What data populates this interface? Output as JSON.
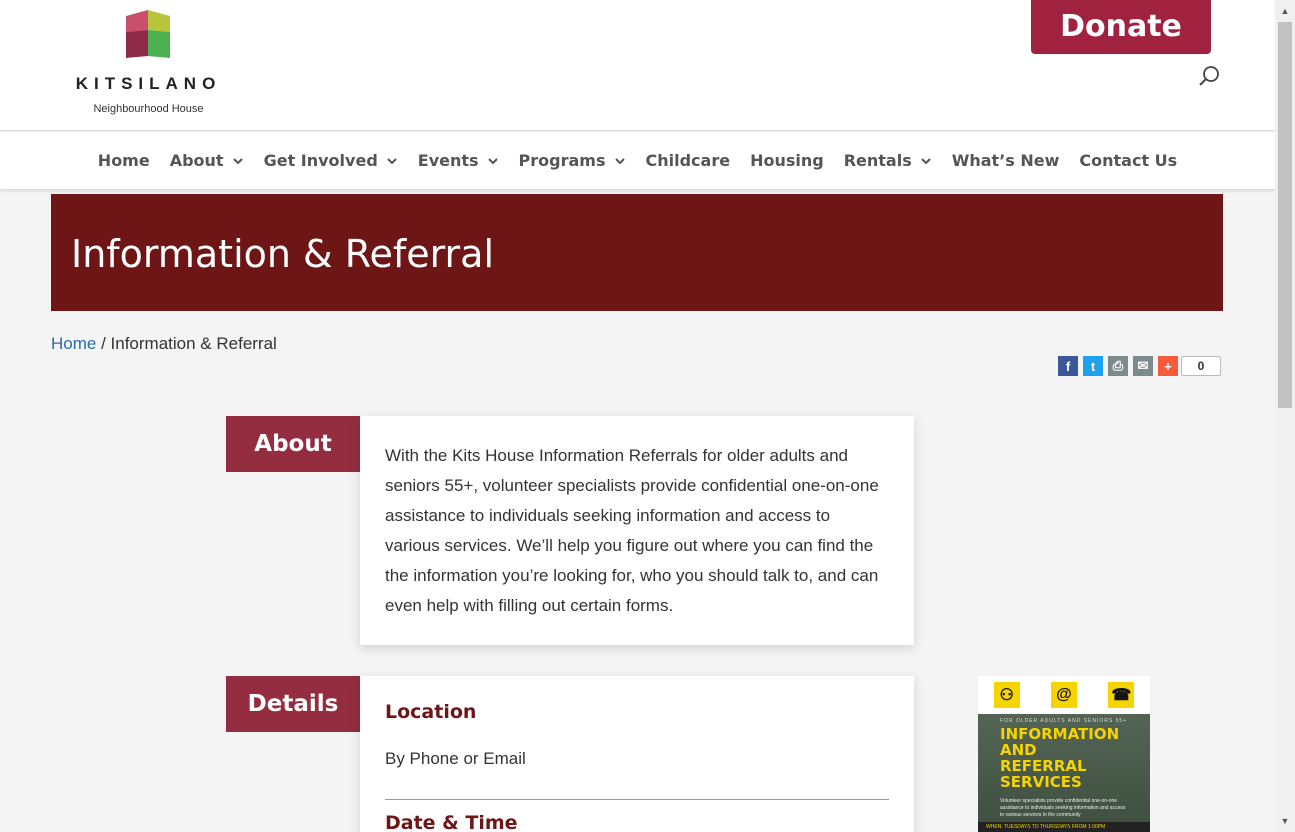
{
  "header": {
    "logo_title": "KITSILANO",
    "logo_subtitle": "Neighbourhood House",
    "donate_label": "Donate"
  },
  "nav": {
    "items": [
      {
        "label": "Home",
        "dropdown": false
      },
      {
        "label": "About",
        "dropdown": true
      },
      {
        "label": "Get Involved",
        "dropdown": true
      },
      {
        "label": "Events",
        "dropdown": true
      },
      {
        "label": "Programs",
        "dropdown": true
      },
      {
        "label": "Childcare",
        "dropdown": false
      },
      {
        "label": "Housing",
        "dropdown": false
      },
      {
        "label": "Rentals",
        "dropdown": true
      },
      {
        "label": "What’s New",
        "dropdown": false
      },
      {
        "label": "Contact Us",
        "dropdown": false
      }
    ]
  },
  "page": {
    "title": "Information & Referral",
    "breadcrumb_home": "Home",
    "breadcrumb_sep": " / ",
    "breadcrumb_current": "Information & Referral"
  },
  "share": {
    "icons": [
      "facebook-icon",
      "twitter-icon",
      "print-icon",
      "email-icon",
      "more-share-icon"
    ],
    "count": "0"
  },
  "about": {
    "label": "About",
    "text": "With the Kits House Information Referrals for older adults and seniors 55+, volunteer specialists provide confidential one-on-one assistance to individuals seeking information and access to various services. We’ll help you figure out where you can find the the information you’re looking for, who you should talk to, and can even help with filling out certain forms."
  },
  "details": {
    "label": "Details",
    "location_heading": "Location",
    "location_value": "By Phone or Email",
    "datetime_heading": "Date & Time"
  },
  "poster": {
    "small_text": "FOR OLDER ADULTS AND SENIORS 55+",
    "title": "INFORMATION AND REFERRAL SERVICES",
    "body": "Volunteer specialists provide confidential one-on-one assistance to individuals seeking information and access to various services in the community",
    "when": "WHEN: TUESDAYS TO THURSDAYS FROM 1:00PM"
  },
  "colors": {
    "donate": "#a0223f",
    "banner": "#6e1516",
    "label_box": "#932d3f",
    "link": "#2a6cb0"
  }
}
